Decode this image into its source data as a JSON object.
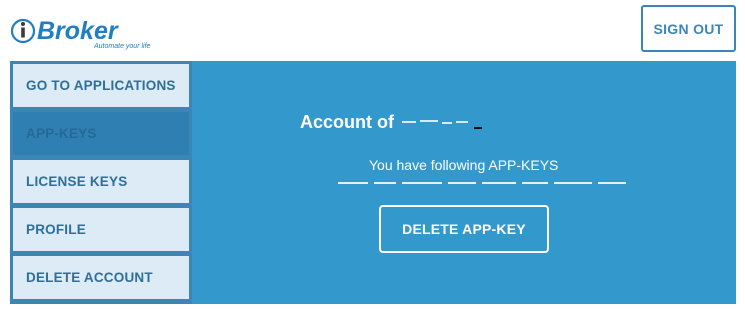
{
  "brand": {
    "name": "Broker",
    "tagline": "Automate your life"
  },
  "header": {
    "sign_out_label": "SIGN OUT"
  },
  "sidebar": {
    "items": [
      {
        "label": "GO TO APPLICATIONS",
        "active": false
      },
      {
        "label": "APP-KEYS",
        "active": true
      },
      {
        "label": "LICENSE KEYS",
        "active": false
      },
      {
        "label": "PROFILE",
        "active": false
      },
      {
        "label": "DELETE ACCOUNT",
        "active": false
      }
    ]
  },
  "main": {
    "account_label": "Account of",
    "keys_caption": "You have following APP-KEYS",
    "delete_label": "DELETE APP-KEY"
  },
  "colors": {
    "accent": "#3399cc",
    "sidebar_bg": "#3a87b7",
    "nav_item_bg": "#dcebf6",
    "brand_blue": "#1f7fc0"
  }
}
